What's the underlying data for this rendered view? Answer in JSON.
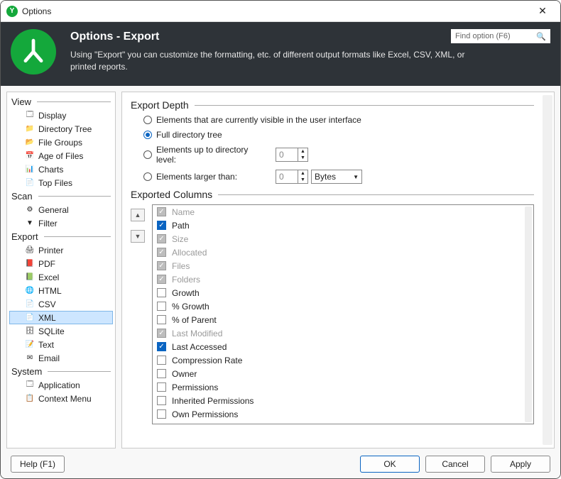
{
  "window": {
    "title": "Options"
  },
  "header": {
    "title": "Options - Export",
    "description": "Using \"Export\" you can customize the formatting, etc. of different output formats like Excel, CSV, XML, or printed reports.",
    "search_placeholder": "Find option (F6)"
  },
  "sidebar": {
    "groups": [
      {
        "label": "View",
        "items": [
          {
            "label": "Display",
            "icon": "display-icon"
          },
          {
            "label": "Directory Tree",
            "icon": "tree-icon"
          },
          {
            "label": "File Groups",
            "icon": "groups-icon"
          },
          {
            "label": "Age of Files",
            "icon": "calendar-icon"
          },
          {
            "label": "Charts",
            "icon": "chart-icon"
          },
          {
            "label": "Top Files",
            "icon": "top-icon"
          }
        ]
      },
      {
        "label": "Scan",
        "items": [
          {
            "label": "General",
            "icon": "gear-icon"
          },
          {
            "label": "Filter",
            "icon": "funnel-icon"
          }
        ]
      },
      {
        "label": "Export",
        "items": [
          {
            "label": "Printer",
            "icon": "printer-icon"
          },
          {
            "label": "PDF",
            "icon": "pdf-icon"
          },
          {
            "label": "Excel",
            "icon": "excel-icon"
          },
          {
            "label": "HTML",
            "icon": "html-icon"
          },
          {
            "label": "CSV",
            "icon": "csv-icon"
          },
          {
            "label": "XML",
            "icon": "xml-icon",
            "selected": true
          },
          {
            "label": "SQLite",
            "icon": "sqlite-icon"
          },
          {
            "label": "Text",
            "icon": "text-icon"
          },
          {
            "label": "Email",
            "icon": "email-icon"
          }
        ]
      },
      {
        "label": "System",
        "items": [
          {
            "label": "Application",
            "icon": "app-icon"
          },
          {
            "label": "Context Menu",
            "icon": "context-icon"
          }
        ]
      }
    ]
  },
  "depth": {
    "section_label": "Export Depth",
    "radios": {
      "visible": {
        "label": "Elements that are currently visible in the user interface",
        "checked": false
      },
      "full": {
        "label": "Full directory tree",
        "checked": true
      },
      "upto": {
        "label": "Elements up to directory level:",
        "checked": false,
        "value": "0"
      },
      "larger": {
        "label": "Elements larger than:",
        "checked": false,
        "value": "0",
        "unit": "Bytes"
      }
    }
  },
  "columns": {
    "section_label": "Exported Columns",
    "items": [
      {
        "label": "Name",
        "state": "locked"
      },
      {
        "label": "Path",
        "state": "checked"
      },
      {
        "label": "Size",
        "state": "locked"
      },
      {
        "label": "Allocated",
        "state": "locked"
      },
      {
        "label": "Files",
        "state": "locked"
      },
      {
        "label": "Folders",
        "state": "locked"
      },
      {
        "label": "Growth",
        "state": "unchecked"
      },
      {
        "label": "% Growth",
        "state": "unchecked"
      },
      {
        "label": "% of Parent",
        "state": "unchecked"
      },
      {
        "label": "Last Modified",
        "state": "locked"
      },
      {
        "label": "Last Accessed",
        "state": "checked"
      },
      {
        "label": "Compression Rate",
        "state": "unchecked"
      },
      {
        "label": "Owner",
        "state": "unchecked"
      },
      {
        "label": "Permissions",
        "state": "unchecked"
      },
      {
        "label": "Inherited Permissions",
        "state": "unchecked"
      },
      {
        "label": "Own Permissions",
        "state": "unchecked"
      }
    ]
  },
  "footer": {
    "help": "Help (F1)",
    "ok": "OK",
    "cancel": "Cancel",
    "apply": "Apply"
  },
  "icons": {
    "display-icon": "🗔",
    "tree-icon": "📁",
    "groups-icon": "📂",
    "calendar-icon": "📅",
    "chart-icon": "📊",
    "top-icon": "📄",
    "gear-icon": "⚙",
    "funnel-icon": "▼",
    "printer-icon": "🖨",
    "pdf-icon": "📕",
    "excel-icon": "📗",
    "html-icon": "🌐",
    "csv-icon": "📄",
    "xml-icon": "📄",
    "sqlite-icon": "🗄",
    "text-icon": "📝",
    "email-icon": "✉",
    "app-icon": "🗔",
    "context-icon": "📋"
  }
}
